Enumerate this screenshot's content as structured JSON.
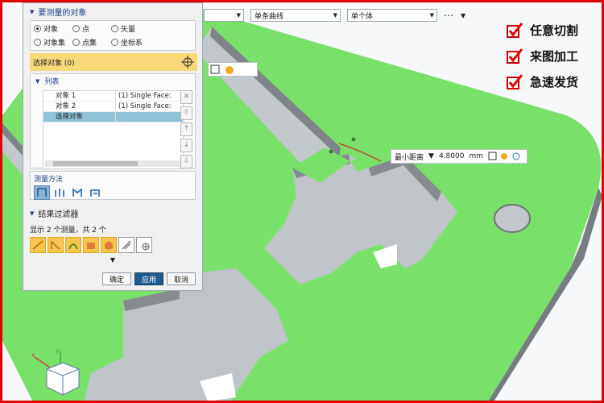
{
  "selection_bar": {
    "combo2": "单条曲线",
    "combo3": "单个体"
  },
  "dialog": {
    "section_title": "要测量的对象",
    "radios": [
      {
        "label": "对象",
        "checked": true
      },
      {
        "label": "点",
        "checked": false
      },
      {
        "label": "矢量",
        "checked": false
      },
      {
        "label": "对象集",
        "checked": false
      },
      {
        "label": "点集",
        "checked": false
      },
      {
        "label": "坐标系",
        "checked": false
      }
    ],
    "select_label": "选择对象 (0)",
    "list_title": "列表",
    "list_rows": [
      {
        "name": "对象 1",
        "value": "(1) Single Face: "
      },
      {
        "name": "对象 2",
        "value": "(1) Single Face: "
      },
      {
        "name": "选择对象",
        "value": ""
      }
    ],
    "method_label": "测量方法",
    "filter_title": "结果过滤器",
    "filter_count": "显示 2 个测量，共 2 个",
    "ok": "确定",
    "apply": "应用",
    "cancel": "取消"
  },
  "measure": {
    "mode": "最小距离",
    "value": "4.8000",
    "unit": "mm"
  },
  "badges": [
    "任意切割",
    "来图加工",
    "急速发货"
  ],
  "colors": {
    "part": "#79e06a",
    "frame": "#e10000",
    "primary": "#1f5a91",
    "select": "#f8d97a"
  }
}
